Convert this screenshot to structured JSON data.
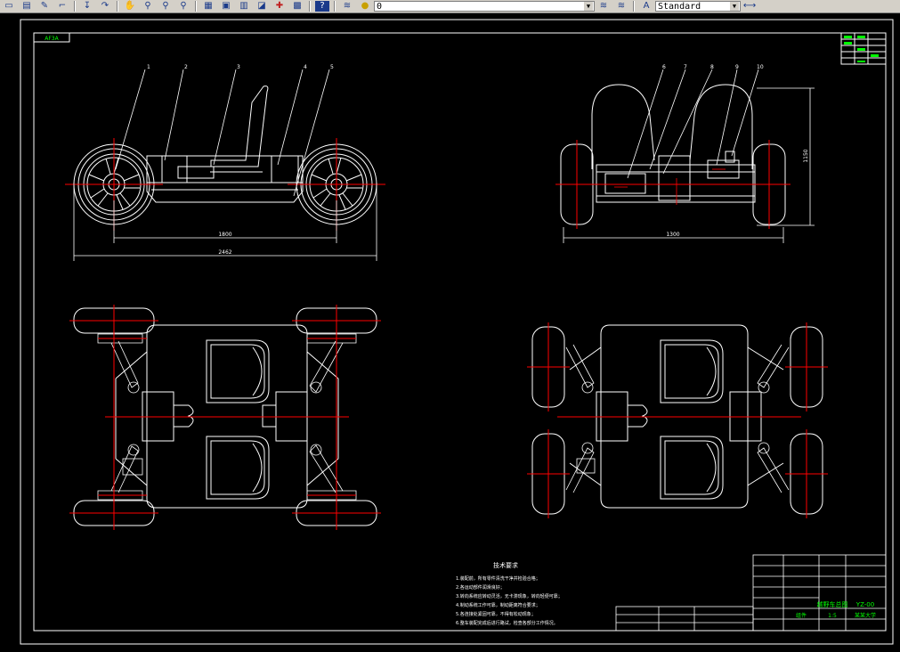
{
  "toolbar": {
    "layer_value": "0",
    "text_style_value": "Standard",
    "icons": [
      "new-icon",
      "open-icon",
      "pencil-icon",
      "match-properties-icon",
      "pan-arrow-icon",
      "redo-icon",
      "pan-hand-icon",
      "zoom-realtime-icon",
      "zoom-window-icon",
      "zoom-previous-icon",
      "properties-icon",
      "design-center-icon",
      "tool-palettes-icon",
      "sheet-set-icon",
      "markup-icon",
      "calculator-icon",
      "help-icon",
      "layer-manager-icon",
      "layer-state-icon",
      "text-style-icon"
    ]
  },
  "drawing": {
    "corner_tag": "AF3A",
    "front_view": {
      "part_numbers": [
        "1",
        "2",
        "3",
        "4",
        "5"
      ],
      "wheelbase_dim": "1800",
      "overall_length_dim": "2462"
    },
    "side_view": {
      "part_numbers": [
        "6",
        "7",
        "8",
        "9",
        "10"
      ],
      "track_dim": "1300",
      "height_dim": "1150"
    },
    "tech_requirements": {
      "title": "技术要求",
      "lines": [
        "1.装配前，所有零件清洗干净并检验合格；",
        "2.各运动部件润滑良好；",
        "3.转向系统应转动灵活，无卡滞现象，转向轻便可靠；",
        "4.制动系统工作可靠，制动距离符合要求；",
        "5.各连接处紧固可靠，不得有松动现象；",
        "6.整车装配完成后进行路试，检查各部分工作情况。"
      ]
    },
    "title_block": {
      "drawing_title": "越野车总图",
      "drawing_no": "YZ-00",
      "scale": "1:5",
      "material": "组件",
      "company": "某某大学"
    }
  },
  "colors": {
    "background": "#000000",
    "line": "#ffffff",
    "center_line": "#ff0000",
    "title_accent": "#00ff00"
  }
}
